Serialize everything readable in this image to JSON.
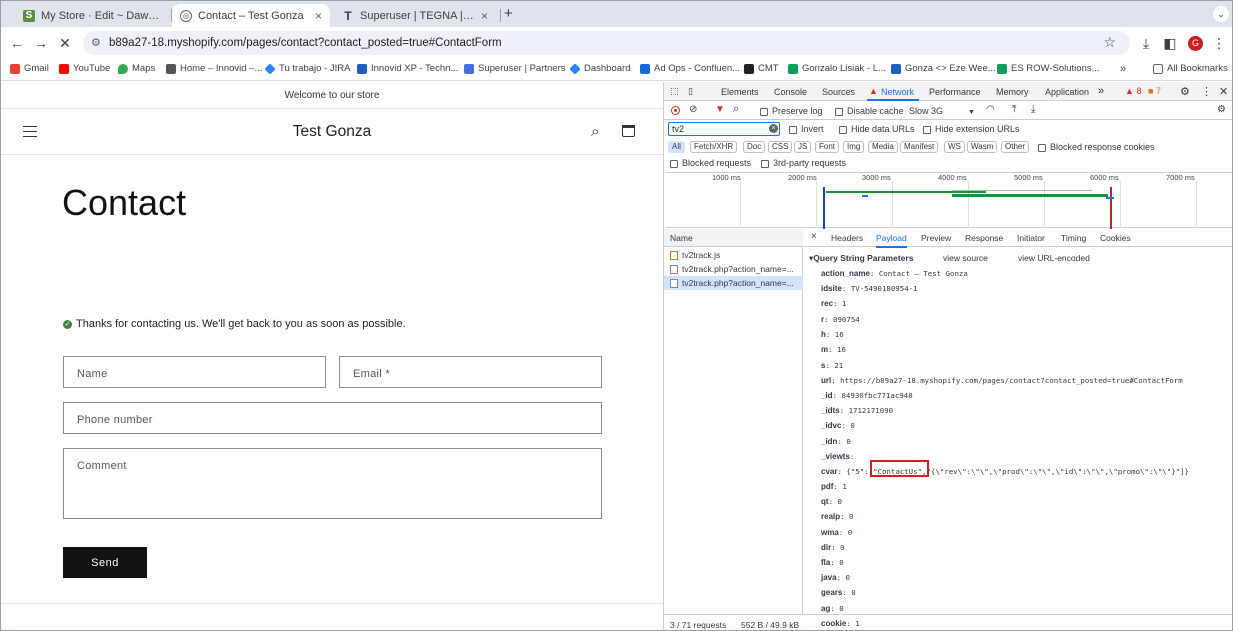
{
  "browser": {
    "tabs": [
      {
        "title": "My Store · Edit ~ Dawn · Shop",
        "close": "×"
      },
      {
        "title": "Contact – Test Gonza",
        "close": "×"
      },
      {
        "title": "Superuser | TEGNA | Qiyin Te",
        "close": "×"
      }
    ],
    "new_tab": "+",
    "url": "b89a27-18.myshopify.com/pages/contact?contact_posted=true#ContactForm",
    "bookmarks": [
      "Gmail",
      "YouTube",
      "Maps",
      "Home – Innovid –...",
      "Tu trabajo - JIRA",
      "Innovid XP - Techn...",
      "Superuser | Partners",
      "Dashboard",
      "Ad Ops - Confluen...",
      "CMT",
      "Gonzalo Lisiak - L...",
      "Gonza <> Eze Wee...",
      "ES ROW-Solutions..."
    ],
    "all_bookmarks": "All Bookmarks",
    "profile_initial": "G",
    "colors": {
      "tabstrip": "#dfe3eb",
      "accent": "#1a73e8",
      "profile": "#c5221f"
    }
  },
  "store": {
    "announcement": "Welcome to our store",
    "name": "Test Gonza",
    "heading": "Contact",
    "success": "Thanks for contacting us. We'll get back to you as soon as possible.",
    "form": {
      "name_label": "Name",
      "email_label": "Email *",
      "phone_label": "Phone number",
      "comment_label": "Comment",
      "send_label": "Send"
    }
  },
  "devtools": {
    "panels": [
      "Elements",
      "Console",
      "Sources",
      "Network",
      "Performance",
      "Memory",
      "Application"
    ],
    "more_panels": "»",
    "warnings": "8",
    "errors": "7",
    "preserve_log": "Preserve log",
    "disable_cache": "Disable cache",
    "throttle": "Slow 3G",
    "filter_value": "tv2",
    "invert": "Invert",
    "hide_data_urls": "Hide data URLs",
    "hide_extension_urls": "Hide extension URLs",
    "type_filters": [
      "All",
      "Fetch/XHR",
      "Doc",
      "CSS",
      "JS",
      "Font",
      "Img",
      "Media",
      "Manifest",
      "WS",
      "Wasm",
      "Other"
    ],
    "blocked_cookies": "Blocked response cookies",
    "blocked_requests": "Blocked requests",
    "third_party": "3rd-party requests",
    "timeline_ticks": [
      "1000 ms",
      "2000 ms",
      "3000 ms",
      "4000 ms",
      "5000 ms",
      "6000 ms",
      "7000 ms"
    ],
    "name_header": "Name",
    "requests": [
      "tv2track.js",
      "tv2track.php?action_name=...",
      "tv2track.php?action_name=..."
    ],
    "status": "3 / 71 requests",
    "transferred": "552 B / 49.9 kB",
    "detail_tabs": [
      "Headers",
      "Payload",
      "Preview",
      "Response",
      "Initiator",
      "Timing",
      "Cookies"
    ],
    "close_detail": "×",
    "section_title": "Query String Parameters",
    "view_source": "view source",
    "view_url_encoded": "view URL-encoded",
    "params": [
      {
        "k": "action_name",
        "v": "Contact – Test Gonza"
      },
      {
        "k": "idsite",
        "v": "TV-5490180954-1"
      },
      {
        "k": "rec",
        "v": "1"
      },
      {
        "k": "r",
        "v": "090754"
      },
      {
        "k": "h",
        "v": "16"
      },
      {
        "k": "m",
        "v": "16"
      },
      {
        "k": "s",
        "v": "21"
      },
      {
        "k": "url",
        "v": "https://b89a27-18.myshopify.com/pages/contact?contact_posted=true#ContactForm"
      },
      {
        "k": "_id",
        "v": "84930fbc771ac948"
      },
      {
        "k": "_idts",
        "v": "1712171090"
      },
      {
        "k": "_idvc",
        "v": "0"
      },
      {
        "k": "_idn",
        "v": "0"
      },
      {
        "k": "_viewts",
        "v": ""
      },
      {
        "k": "cvar",
        "v": "{\"5\":[\"ContactUs\",\"{\\\"rev\\\":\\\"\\\",\\\"prod\\\":\\\"\\\",\\\"id\\\":\\\"\\\",\\\"promo\\\":\\\"\\\"}\"]}"
      },
      {
        "k": "pdf",
        "v": "1"
      },
      {
        "k": "qt",
        "v": "0"
      },
      {
        "k": "realp",
        "v": "0"
      },
      {
        "k": "wma",
        "v": "0"
      },
      {
        "k": "dir",
        "v": "0"
      },
      {
        "k": "fla",
        "v": "0"
      },
      {
        "k": "java",
        "v": "0"
      },
      {
        "k": "gears",
        "v": "0"
      },
      {
        "k": "ag",
        "v": "0"
      },
      {
        "k": "cookie",
        "v": "1"
      }
    ]
  }
}
